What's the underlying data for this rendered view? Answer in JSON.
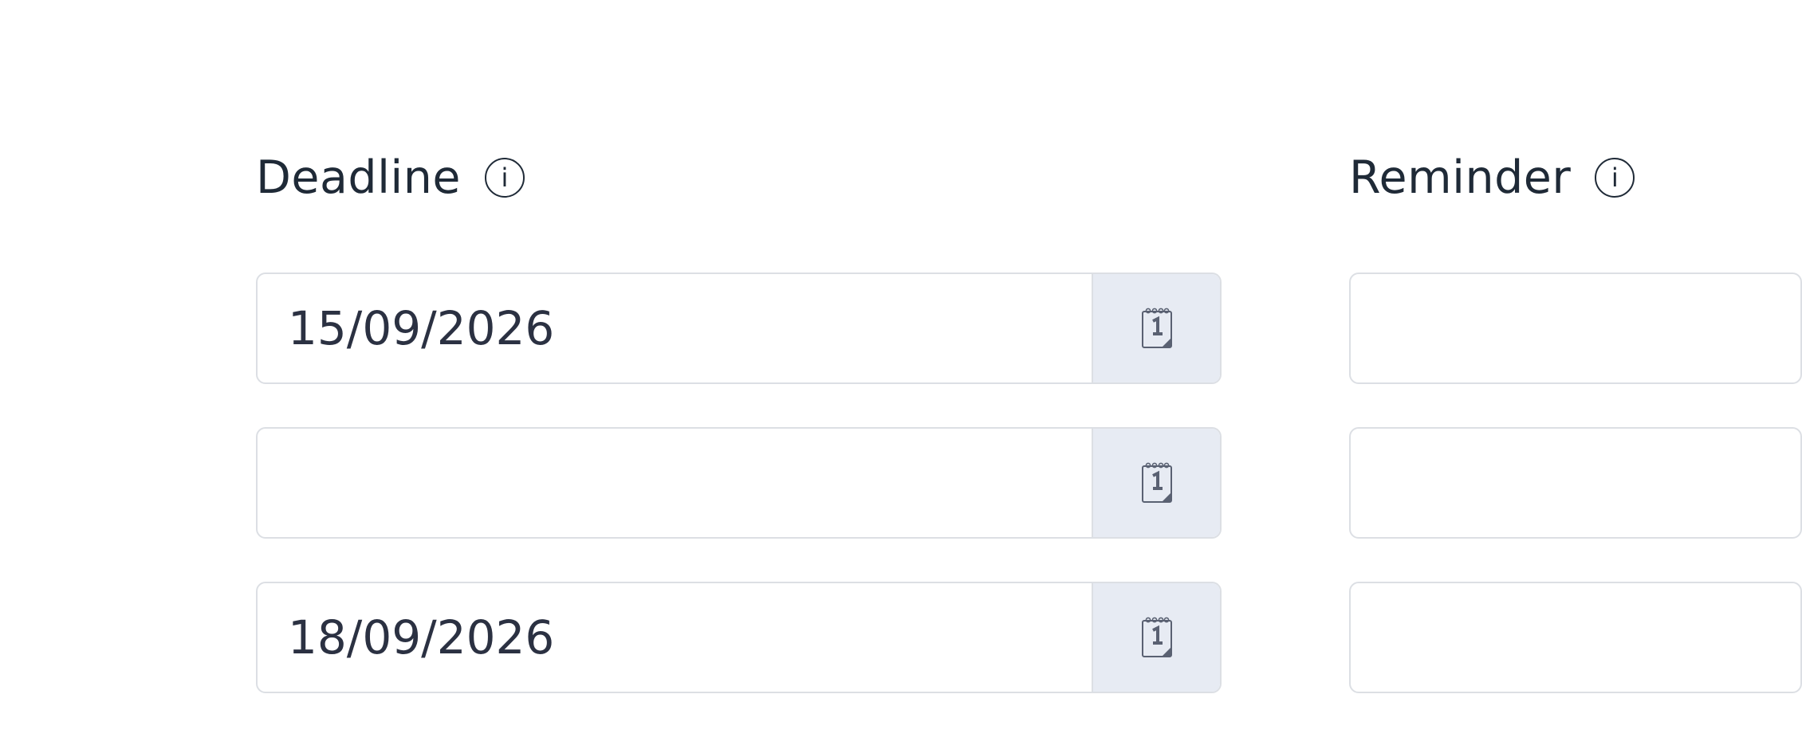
{
  "deadline": {
    "title": "Deadline",
    "info_glyph": "i",
    "info_icon": "info-circle-icon",
    "rows": [
      {
        "value": "15/09/2026",
        "calendar_icon": "calendar-icon"
      },
      {
        "value": "",
        "calendar_icon": "calendar-icon"
      },
      {
        "value": "18/09/2026",
        "calendar_icon": "calendar-icon"
      }
    ]
  },
  "reminder": {
    "title": "Reminder",
    "info_glyph": "i",
    "info_icon": "info-circle-icon",
    "rows": [
      {
        "value": ""
      },
      {
        "value": ""
      },
      {
        "value": ""
      }
    ]
  },
  "colors": {
    "text": "#1f2a37",
    "border": "#dcdfe4",
    "calendar_bg": "#e7ebf3",
    "icon": "#5a6172"
  }
}
